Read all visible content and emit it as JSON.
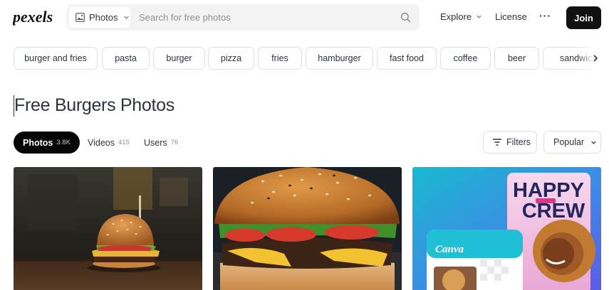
{
  "header": {
    "logo_text": "pexels",
    "search": {
      "type_label": "Photos",
      "placeholder": "Search for free photos"
    },
    "nav": {
      "explore_label": "Explore",
      "license_label": "License",
      "more_label": "···",
      "join_label": "Join"
    }
  },
  "related_searches": [
    "burger and fries",
    "pasta",
    "burger",
    "pizza",
    "fries",
    "hamburger",
    "fast food",
    "coffee",
    "beer",
    "sandwich"
  ],
  "page_title": "Free Burgers Photos",
  "tabs": [
    {
      "label": "Photos",
      "count": "3.8K",
      "active": true
    },
    {
      "label": "Videos",
      "count": "415",
      "active": false
    },
    {
      "label": "Users",
      "count": "76",
      "active": false
    }
  ],
  "toolbar": {
    "filters_label": "Filters",
    "sort_label": "Popular"
  },
  "photos": [
    {
      "subject": "burger on wooden table with skewer"
    },
    {
      "subject": "close-up cheeseburger with tomato and lettuce"
    },
    {
      "subject": "Canva promotional card",
      "headline_1": "HAPPY",
      "headline_2": "CREW",
      "brand": "Canva"
    }
  ],
  "colors": {
    "text": "#2c343e",
    "join_bg": "#111111",
    "chip_border": "#dfdfe0",
    "search_bg": "#f3f3f3",
    "canva_teal": "#1ec0d4",
    "canva_purple": "#7d2ae8"
  }
}
